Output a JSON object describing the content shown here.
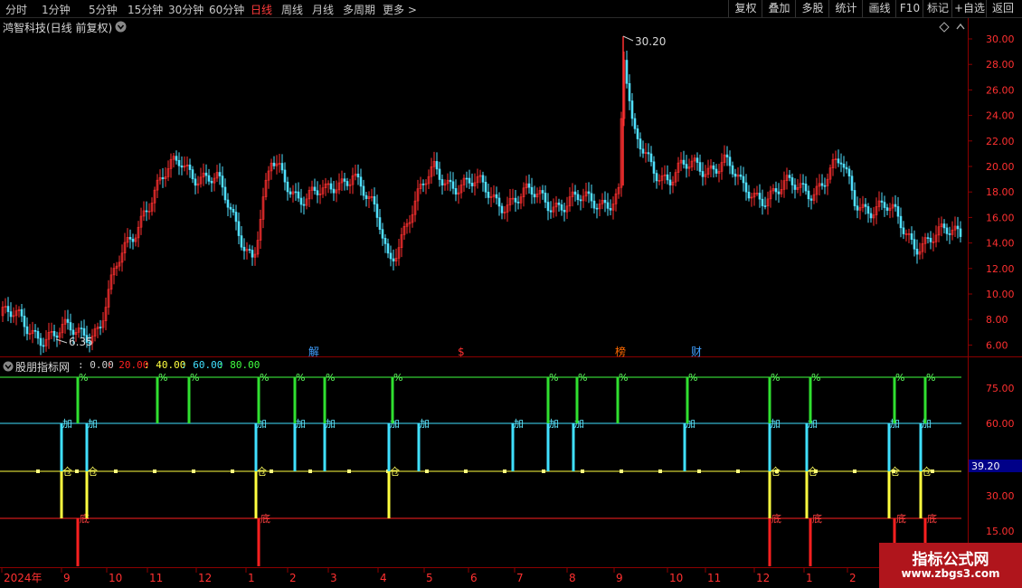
{
  "toolbar": {
    "periods": [
      "分时",
      "1分钟",
      "5分钟",
      "15分钟",
      "30分钟",
      "60分钟",
      "日线",
      "周线",
      "月线",
      "多周期",
      "更多 >"
    ],
    "active_period": "日线",
    "right_buttons": [
      "复权",
      "叠加",
      "多股",
      "统计",
      "画线",
      "F10",
      "标记",
      "+自选",
      "返回"
    ]
  },
  "chart": {
    "title": "鸿智科技(日线 前复权)",
    "max_label": "30.20",
    "min_label": "6.35",
    "price_ticks": [
      "30.00",
      "28.00",
      "26.00",
      "24.00",
      "22.00",
      "20.00",
      "18.00",
      "16.00",
      "14.00",
      "12.00",
      "10.00",
      "8.00",
      "6.00"
    ],
    "markers": [
      {
        "text": "解",
        "color": "#40a0ff"
      },
      {
        "text": "$",
        "color": "#ff3030"
      },
      {
        "text": "榜",
        "color": "#ff6a00"
      },
      {
        "text": "财",
        "color": "#40a0ff"
      }
    ]
  },
  "indicator": {
    "name": "股朋指标网",
    "levels": [
      {
        "text": ": 0.00",
        "color": "#d0d0d0"
      },
      {
        "text": ": 20.00",
        "color": "#ff2020"
      },
      {
        "text": ": 40.00",
        "color": "#ffff40"
      },
      {
        "text": ": 60.00",
        "color": "#40e0ff"
      },
      {
        "text": ": 80.00",
        "color": "#40ff40"
      }
    ],
    "ticks": [
      "75.00",
      "60.00",
      "30.00",
      "15.00"
    ],
    "current_value": "39.20",
    "signal_labels": {
      "bottom": "底",
      "warehouse": "仓",
      "add": "加",
      "sell": "%"
    }
  },
  "time_axis": [
    "2024年",
    "9",
    "10",
    "11",
    "12",
    "1",
    "2",
    "3",
    "4",
    "5",
    "6",
    "7",
    "8",
    "9",
    "10",
    "11",
    "12",
    "1",
    "2"
  ],
  "watermark": {
    "line1": "指标公式网",
    "line2": "www.zbgs3.com"
  },
  "colors": {
    "up": "#ff3030",
    "down": "#50e0ff",
    "grid": "#8b0000"
  }
}
